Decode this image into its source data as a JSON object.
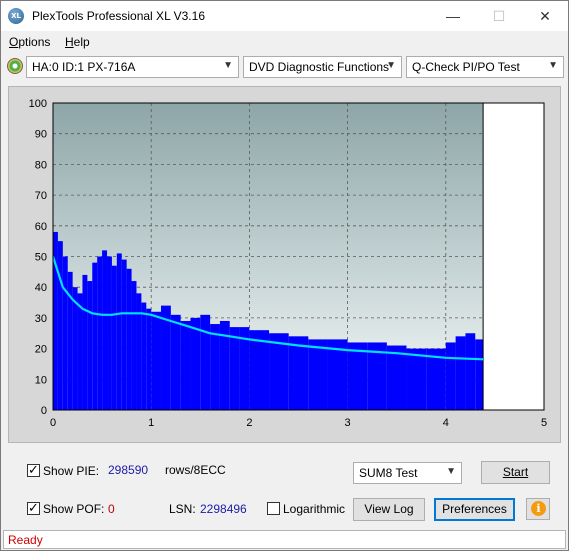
{
  "window": {
    "title": "PlexTools Professional XL V3.16",
    "icon_text": "XL"
  },
  "menu": {
    "options": "ptions",
    "options_mnemonic": "O",
    "help": "elp",
    "help_mnemonic": "H"
  },
  "toolbar": {
    "drive": "HA:0 ID:1  PX-716A",
    "function": "DVD Diagnostic Functions",
    "test": "Q-Check PI/PO Test"
  },
  "chart_data": {
    "type": "area",
    "xlim": [
      0,
      5
    ],
    "ylim": [
      0,
      100
    ],
    "x_ticks": [
      "0",
      "1",
      "2",
      "3",
      "4",
      "5"
    ],
    "y_ticks": [
      "0",
      "10",
      "20",
      "30",
      "40",
      "50",
      "60",
      "70",
      "80",
      "90",
      "100"
    ],
    "grid": true,
    "end_marker_x": 4.38,
    "series": [
      {
        "kind": "bars",
        "color": "#0000ff",
        "x": [
          0.0,
          0.05,
          0.1,
          0.15,
          0.2,
          0.25,
          0.3,
          0.35,
          0.4,
          0.45,
          0.5,
          0.55,
          0.6,
          0.65,
          0.7,
          0.75,
          0.8,
          0.85,
          0.9,
          0.95,
          1.0,
          1.1,
          1.2,
          1.3,
          1.4,
          1.5,
          1.6,
          1.7,
          1.8,
          1.9,
          2.0,
          2.2,
          2.4,
          2.6,
          2.8,
          3.0,
          3.2,
          3.4,
          3.6,
          3.8,
          4.0,
          4.1,
          4.2,
          4.3,
          4.38
        ],
        "y": [
          58,
          55,
          50,
          45,
          40,
          38,
          44,
          42,
          48,
          50,
          52,
          50,
          47,
          51,
          49,
          46,
          42,
          38,
          35,
          33,
          32,
          34,
          31,
          29,
          30,
          31,
          28,
          29,
          27,
          27,
          26,
          25,
          24,
          23,
          23,
          22,
          22,
          21,
          20,
          20,
          22,
          24,
          25,
          23,
          22
        ]
      },
      {
        "kind": "line",
        "color": "#00e0ff",
        "x": [
          0.0,
          0.05,
          0.1,
          0.2,
          0.3,
          0.4,
          0.5,
          0.6,
          0.7,
          0.8,
          0.9,
          1.0,
          1.2,
          1.4,
          1.6,
          1.8,
          2.0,
          2.5,
          3.0,
          3.5,
          4.0,
          4.38
        ],
        "y": [
          50,
          45,
          40,
          36,
          33,
          31.5,
          31,
          31,
          31.5,
          31.5,
          31.5,
          31,
          29,
          27,
          25,
          24,
          23,
          21,
          19.5,
          18.5,
          17,
          16.5
        ]
      }
    ]
  },
  "controls": {
    "show_pie_label": "Show PIE:",
    "pie_value": "298590",
    "pie_unit": "rows/8ECC",
    "show_pof_label": "Show POF:",
    "pof_value": "0",
    "lsn_label": "LSN:",
    "lsn_value": "2298496",
    "logarithmic_label": "Logarithmic",
    "sum_test": "SUM8 Test",
    "start_button": "Start",
    "view_log_button": "View Log",
    "preferences_button": "Preferences",
    "info_glyph": "i"
  },
  "status": {
    "text": "Ready"
  }
}
